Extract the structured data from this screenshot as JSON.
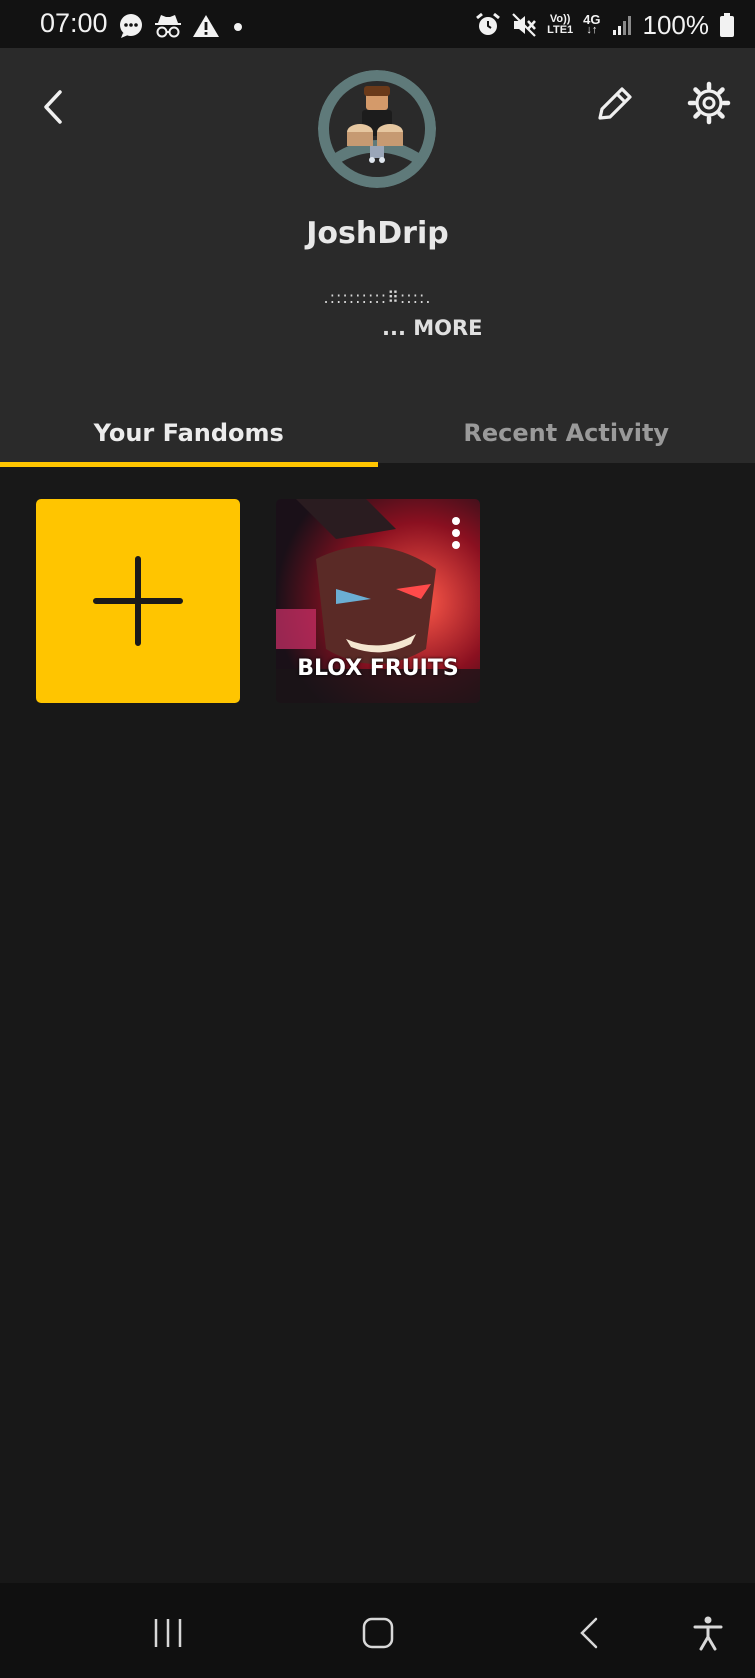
{
  "status_bar": {
    "time": "07:00",
    "left_icons": [
      "message-icon",
      "incognito-icon",
      "warning-icon",
      "dot-icon"
    ],
    "right_icons": [
      "alarm-icon",
      "mute-icon",
      "volte-icon",
      "4g-icon",
      "signal-icon",
      "battery-icon"
    ],
    "network_top": "Vo))",
    "network_bottom": "LTE1",
    "network_type": "4G",
    "battery": "100%"
  },
  "profile": {
    "username": "JoshDrip",
    "bio": ".:::::::::⠿::::.",
    "more_label": "... MORE"
  },
  "header_actions": [
    "back-icon",
    "edit-icon",
    "settings-icon"
  ],
  "tabs": [
    {
      "label": "Your Fandoms",
      "active": true
    },
    {
      "label": "Recent Activity",
      "active": false
    }
  ],
  "fandoms": [
    {
      "name": "BLOX FRUITS"
    }
  ],
  "accent_color": "#ffc500",
  "nav_bar": [
    "recent-apps-icon",
    "home-icon",
    "back-icon",
    "accessibility-icon"
  ]
}
